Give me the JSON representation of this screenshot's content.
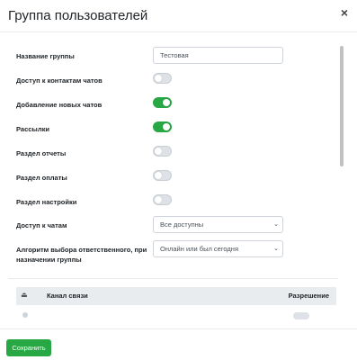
{
  "header": {
    "title": "Группа пользователей",
    "close_label": "×"
  },
  "form": {
    "group_name_label": "Название группы",
    "group_name_value": "Тестовая",
    "toggles": [
      {
        "label": "Доступ к контактам чатов",
        "on": false
      },
      {
        "label": "Добавление новых чатов",
        "on": true
      },
      {
        "label": "Рассылки",
        "on": true
      },
      {
        "label": "Раздел отчеты",
        "on": false
      },
      {
        "label": "Раздел оплаты",
        "on": false
      },
      {
        "label": "Раздел настройки",
        "on": false
      }
    ],
    "chat_access_label": "Доступ к чатам",
    "chat_access_value": "Все доступны",
    "algo_label": "Алгоритм выбора ответственного, при назначении группы",
    "algo_value": "Онлайн или был сегодня"
  },
  "table": {
    "col_channel": "Канал связи",
    "col_permission": "Разрешение"
  },
  "footer": {
    "save_label": "Сохранить"
  },
  "colors": {
    "accent": "#28a745",
    "toggle_off": "#dee2e6"
  }
}
